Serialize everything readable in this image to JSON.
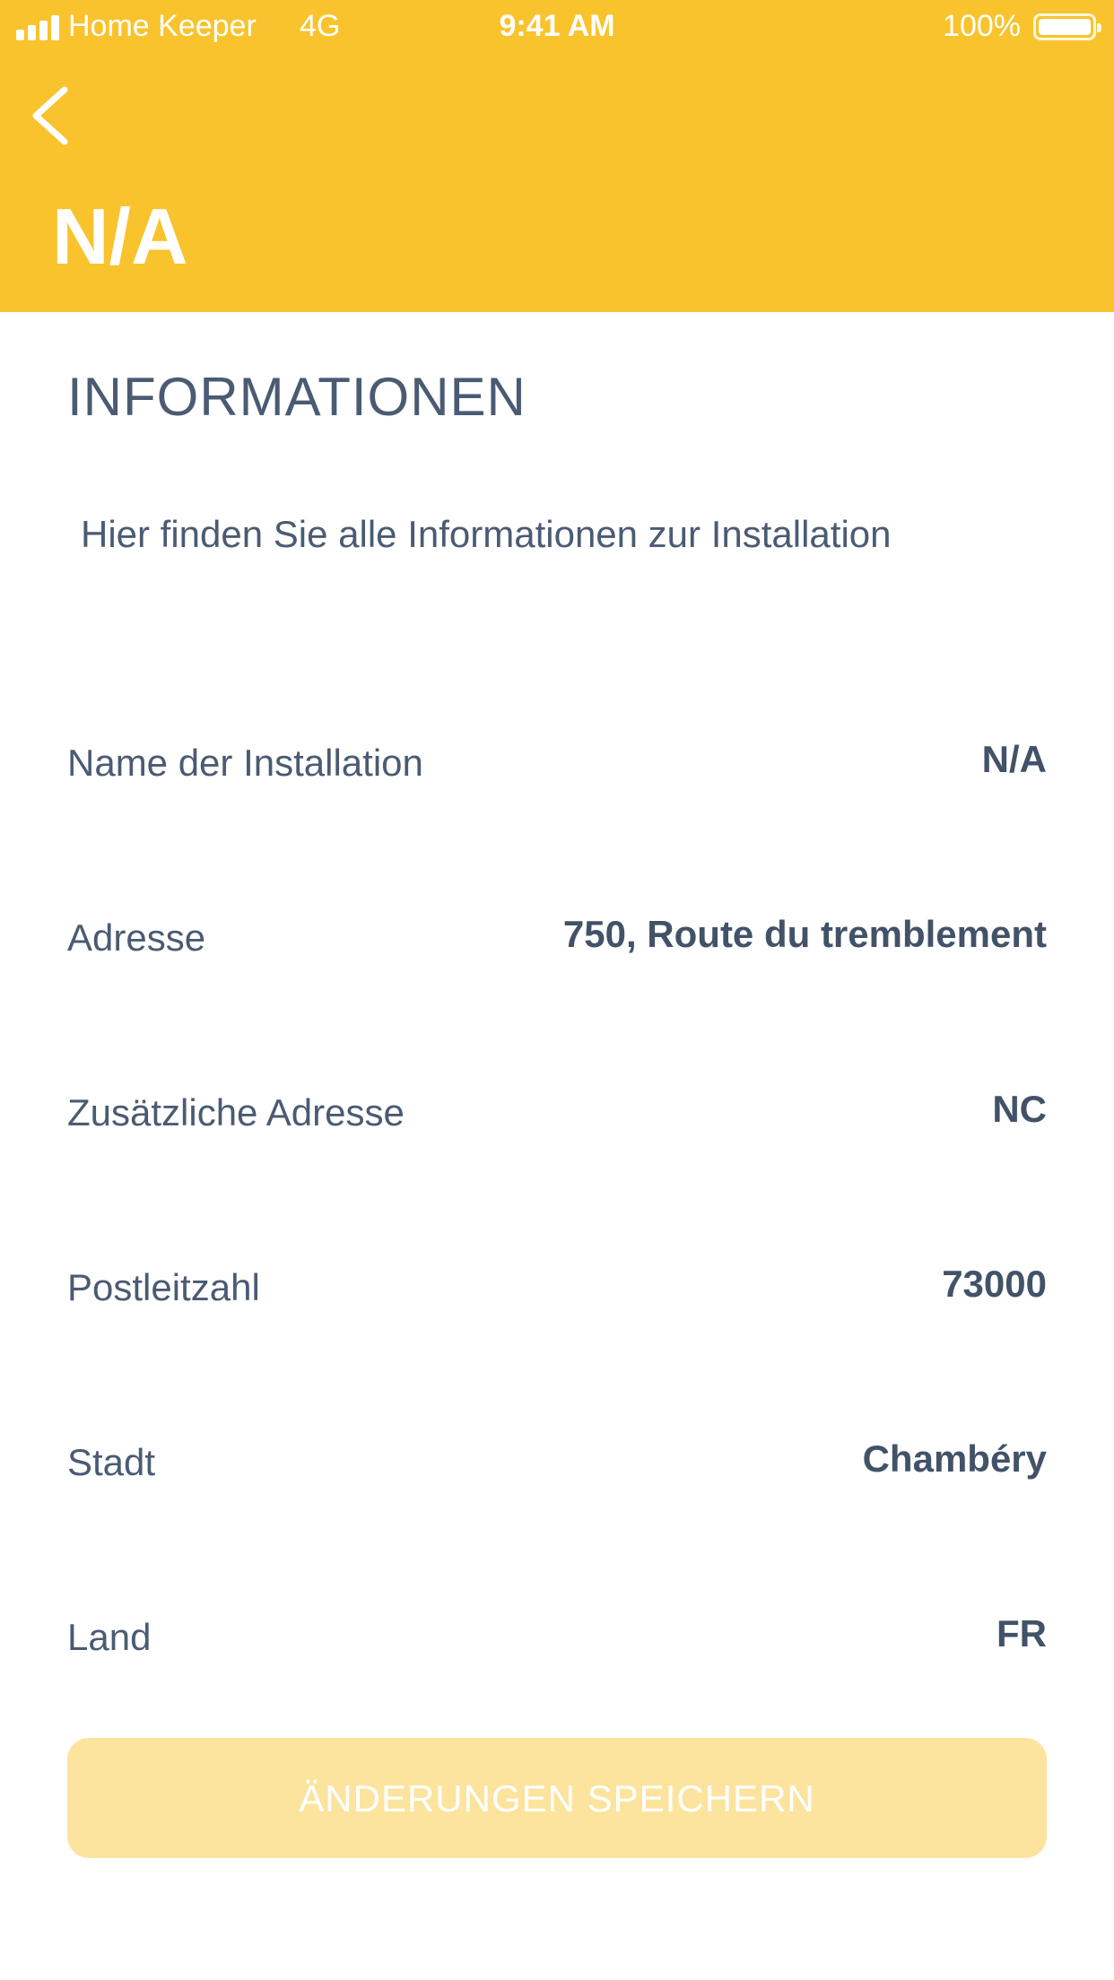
{
  "status_bar": {
    "carrier": "Home Keeper",
    "network": "4G",
    "time": "9:41 AM",
    "battery": "100%"
  },
  "header": {
    "title": "N/A",
    "back_icon": "chevron-left-icon",
    "background_color": "#F9C32D"
  },
  "section": {
    "title": "INFORMATIONEN",
    "description": "Hier finden Sie alle Informationen zur Installation"
  },
  "fields": [
    {
      "label": "Name der Installation",
      "value": "N/A"
    },
    {
      "label": "Adresse",
      "value": "750, Route du tremblement"
    },
    {
      "label": "Zusätzliche Adresse",
      "value": "NC"
    },
    {
      "label": "Postleitzahl",
      "value": "73000"
    },
    {
      "label": "Stadt",
      "value": "Chambéry"
    },
    {
      "label": "Land",
      "value": "FR"
    }
  ],
  "actions": {
    "save_label": "ÄNDERUNGEN SPEICHERN",
    "save_color": "#FCE49E"
  }
}
